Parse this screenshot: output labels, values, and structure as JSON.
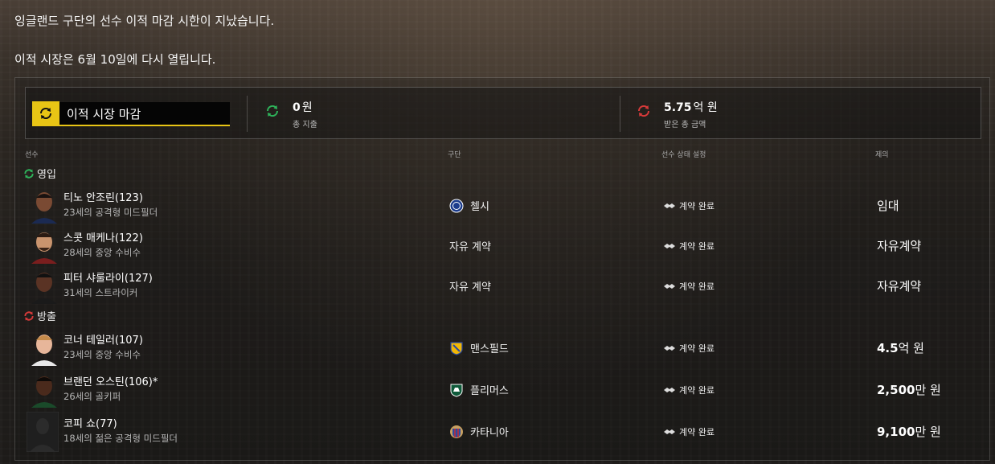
{
  "messages": {
    "line1": "잉글랜드 구단의 선수 이적 마감 시한이 지났습니다.",
    "line2": "이적 시장은 6월 10일에 다시 열립니다."
  },
  "summary": {
    "deadline_label": "이적 시장 마감",
    "spent": {
      "value": "0",
      "unit": "원",
      "label": "총 지출"
    },
    "received": {
      "value": "5.75",
      "unit": "억 원",
      "label": "받은 총 금액"
    }
  },
  "columns": {
    "player": "선수",
    "club": "구단",
    "status": "선수 상태 설정",
    "offer": "제의"
  },
  "sections": {
    "incoming": "영입",
    "outgoing": "방출"
  },
  "incoming": [
    {
      "name": "티노 안조린(123)",
      "desc": "23세의 공격형 미드필더",
      "club": "첼시",
      "status": "계약 완료",
      "offer": "임대"
    },
    {
      "name": "스콧 매케나(122)",
      "desc": "28세의 중앙 수비수",
      "club": "자유 계약",
      "status": "계약 완료",
      "offer": "자유계약"
    },
    {
      "name": "피터 샤룰라이(127)",
      "desc": "31세의 스트라이커",
      "club": "자유 계약",
      "status": "계약 완료",
      "offer": "자유계약"
    }
  ],
  "outgoing": [
    {
      "name": "코너 테일러(107)",
      "desc": "23세의 중앙 수비수",
      "club": "맨스필드",
      "status": "계약 완료",
      "offer_num": "4.5",
      "offer_unit": "억 원"
    },
    {
      "name": "브랜던 오스틴(106)*",
      "desc": "26세의 골키퍼",
      "club": "플리머스",
      "status": "계약 완료",
      "offer_num": "2,500",
      "offer_unit": "만 원"
    },
    {
      "name": "코피 쇼(77)",
      "desc": "18세의 젊은 공격형 미드필더",
      "club": "카타니아",
      "status": "계약 완료",
      "offer_num": "9,100",
      "offer_unit": "만 원"
    }
  ],
  "colors": {
    "accent_yellow": "#e8c515",
    "green": "#2eb35a",
    "red": "#d83a3a"
  }
}
